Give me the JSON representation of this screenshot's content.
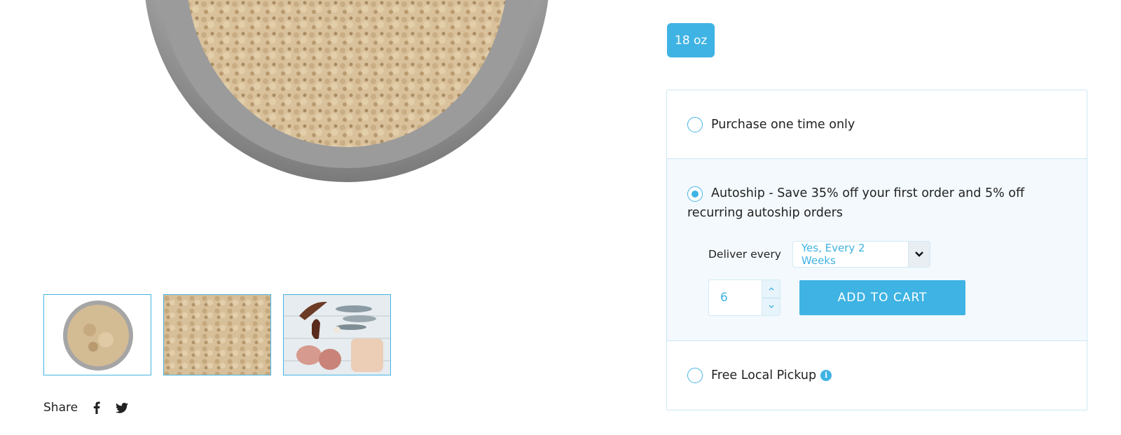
{
  "product": {
    "size_option": "18 oz"
  },
  "gallery": {
    "thumbnails": [
      "ground-food-bowl",
      "ground-food-closeup",
      "raw-ingredients"
    ]
  },
  "share": {
    "label": "Share",
    "icons": [
      "facebook-icon",
      "twitter-icon"
    ]
  },
  "purchase": {
    "one_time_label": "Purchase one time only",
    "autoship_label": "Autoship  - Save 35% off your first order and 5% off recurring autoship orders",
    "deliver_every_label": "Deliver every",
    "deliver_every_value": "Yes, Every 2 Weeks",
    "quantity": "6",
    "add_to_cart_label": "ADD TO CART",
    "pickup_label": "Free Local Pickup",
    "selected_option": "autoship"
  },
  "colors": {
    "accent": "#3fb3e3",
    "panel_border": "#cce8f5",
    "autoship_bg": "#f3f9fd"
  }
}
